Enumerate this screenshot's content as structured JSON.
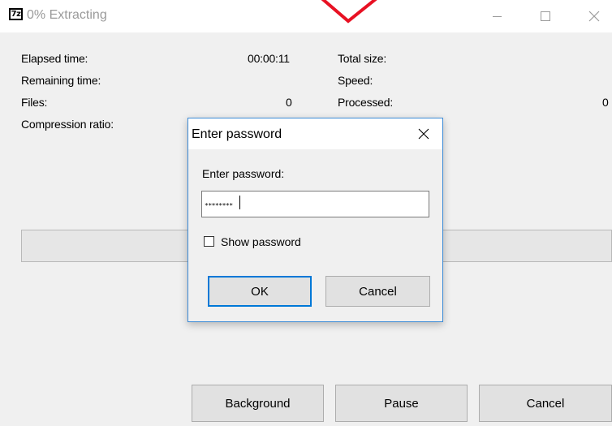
{
  "window": {
    "icon_text": "7z",
    "title": "0% Extracting",
    "controls": {
      "minimize": "minimize",
      "maximize": "maximize",
      "close": "close"
    }
  },
  "stats": {
    "elapsed_label": "Elapsed time:",
    "elapsed_value": "00:00:11",
    "remaining_label": "Remaining time:",
    "remaining_value": "",
    "files_label": "Files:",
    "files_value": "0",
    "ratio_label": "Compression ratio:",
    "ratio_value": "",
    "total_size_label": "Total size:",
    "total_size_value": "",
    "speed_label": "Speed:",
    "speed_value": "",
    "processed_label": "Processed:",
    "processed_value": "0"
  },
  "progress": {
    "percent": 0
  },
  "buttons": {
    "background": "Background",
    "pause": "Pause",
    "cancel": "Cancel"
  },
  "dialog": {
    "title": "Enter password",
    "label": "Enter password:",
    "password_value": "********",
    "show_password_label": "Show password",
    "show_password_checked": false,
    "ok": "OK",
    "cancel": "Cancel"
  },
  "colors": {
    "accent": "#0078d7",
    "overlay_mark": "#e81123",
    "progress": "#06b025"
  }
}
